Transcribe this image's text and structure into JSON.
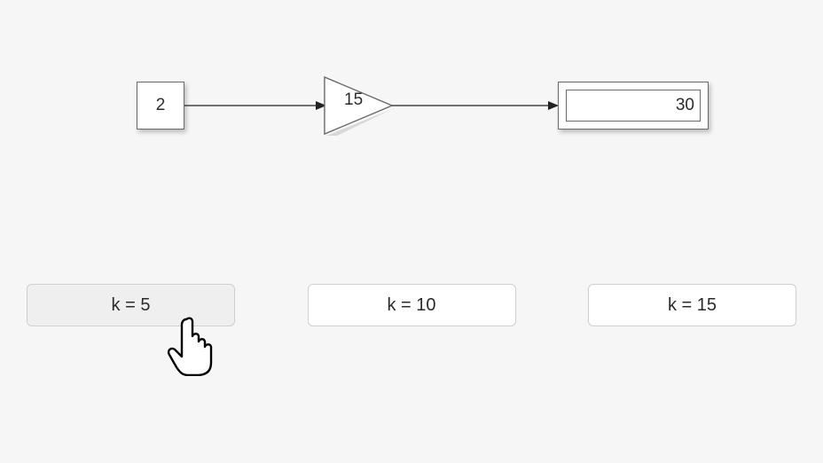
{
  "diagram": {
    "constant_block": {
      "value": "2"
    },
    "gain_block": {
      "value": "15"
    },
    "display_block": {
      "value": "30"
    }
  },
  "buttons": {
    "k5_label": "k = 5",
    "k10_label": "k = 10",
    "k15_label": "k = 15"
  }
}
